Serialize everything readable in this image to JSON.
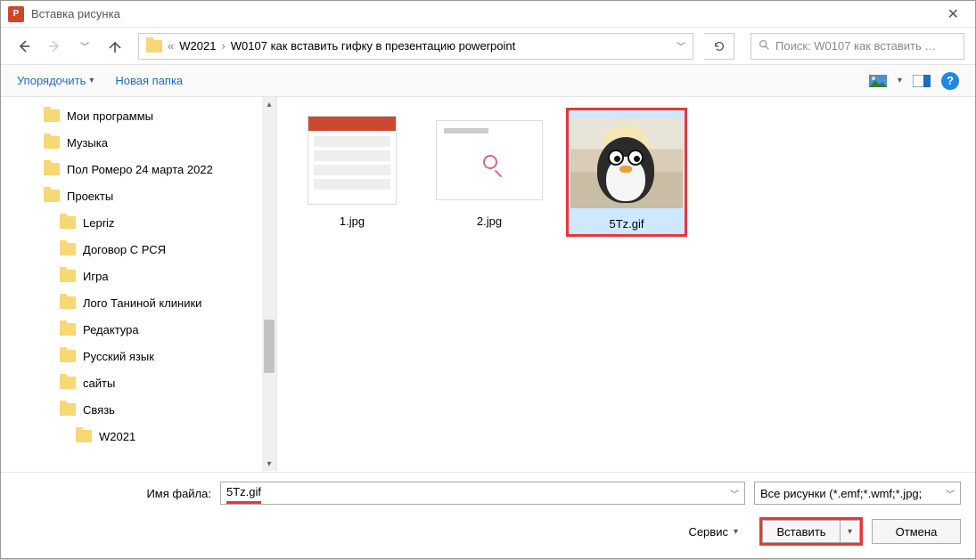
{
  "window": {
    "title": "Вставка рисунка",
    "app_icon_text": "P"
  },
  "nav": {
    "crumb_prefix": "«",
    "crumbs": [
      "W2021",
      "W0107 как вставить гифку в презентацию powerpoint"
    ],
    "search_placeholder": "Поиск: W0107 как вставить …"
  },
  "toolbar": {
    "organize": "Упорядочить",
    "new_folder": "Новая папка"
  },
  "tree": {
    "items": [
      {
        "label": "Мои программы",
        "indent": 1
      },
      {
        "label": "Музыка",
        "indent": 1
      },
      {
        "label": "Пол Ромеро 24 марта 2022",
        "indent": 1
      },
      {
        "label": "Проекты",
        "indent": 1
      },
      {
        "label": "Lepriz",
        "indent": 2
      },
      {
        "label": "Договор С РСЯ",
        "indent": 2
      },
      {
        "label": "Игра",
        "indent": 2
      },
      {
        "label": "Лого Таниной клиники",
        "indent": 2
      },
      {
        "label": "Редактура",
        "indent": 2
      },
      {
        "label": "Русский язык",
        "indent": 2
      },
      {
        "label": "сайты",
        "indent": 2
      },
      {
        "label": "Связь",
        "indent": 2
      },
      {
        "label": "W2021",
        "indent": 3
      }
    ]
  },
  "files": [
    {
      "name": "1.jpg",
      "selected": false,
      "thumb": "t1"
    },
    {
      "name": "2.jpg",
      "selected": false,
      "thumb": "t2"
    },
    {
      "name": "5Tz.gif",
      "selected": true,
      "thumb": "t3"
    }
  ],
  "bottom": {
    "filename_label": "Имя файла:",
    "filename_value": "5Tz.gif",
    "filetype_label": "Все рисунки (*.emf;*.wmf;*.jpg;",
    "service": "Сервис",
    "insert": "Вставить",
    "cancel": "Отмена"
  }
}
